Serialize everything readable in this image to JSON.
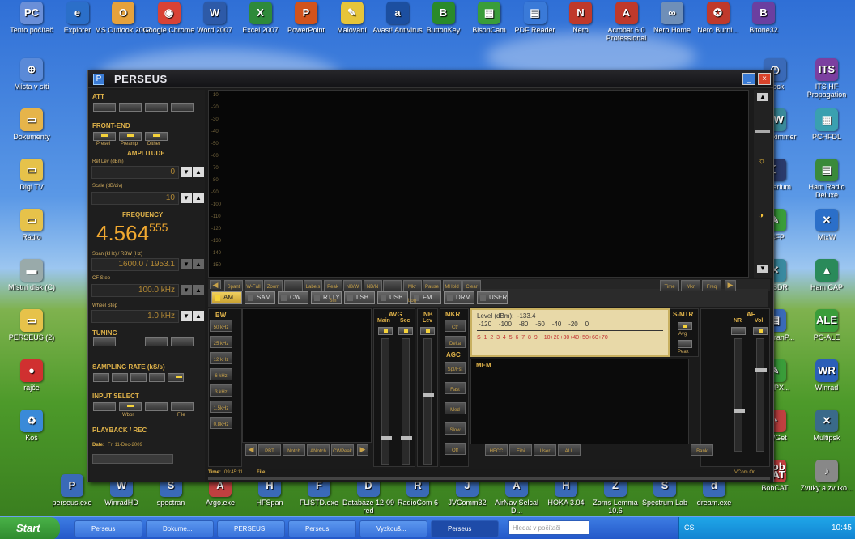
{
  "desktop": {
    "icons": [
      {
        "label": "Tento počítač",
        "color": "#6a8fd8",
        "glyph": "PC"
      },
      {
        "label": "Explorer",
        "color": "#2b6fc9",
        "glyph": "e"
      },
      {
        "label": "MS Outlook 2007",
        "color": "#e6a23c",
        "glyph": "O"
      },
      {
        "label": "Google Chrome",
        "color": "#d94235",
        "glyph": "◉"
      },
      {
        "label": "Word 2007",
        "color": "#2d5aa8",
        "glyph": "W"
      },
      {
        "label": "Excel 2007",
        "color": "#2e8a3a",
        "glyph": "X"
      },
      {
        "label": "PowerPoint",
        "color": "#d2531c",
        "glyph": "P"
      },
      {
        "label": "Malování",
        "color": "#e6c53a",
        "glyph": "✎"
      },
      {
        "label": "Avast! Antivirus",
        "color": "#1c4fa0",
        "glyph": "a"
      },
      {
        "label": "ButtonKey",
        "color": "#2a8a2a",
        "glyph": "B"
      },
      {
        "label": "BisonCam",
        "color": "#3a9d3a",
        "glyph": "▦"
      },
      {
        "label": "PDF Reader",
        "color": "#3a7ad8",
        "glyph": "▤"
      },
      {
        "label": "Nero",
        "color": "#c0392b",
        "glyph": "N"
      },
      {
        "label": "Acrobat 6.0 Professional",
        "color": "#c0392b",
        "glyph": "A"
      },
      {
        "label": "Nero Home",
        "color": "#6f8fb8",
        "glyph": "∞"
      },
      {
        "label": "Nero Burni...",
        "color": "#c0392b",
        "glyph": "✪"
      },
      {
        "label": "Bitone32",
        "color": "#6b3fa0",
        "glyph": "B"
      }
    ],
    "right_icons": [
      {
        "label": "ITS HF Propagation",
        "color": "#7b3fa0",
        "glyph": "ITS"
      },
      {
        "label": "PCHFDL",
        "color": "#3aa0b0",
        "glyph": "▦"
      },
      {
        "label": "Ham Radio Deluxe",
        "color": "#3a8a3a",
        "glyph": "▤"
      },
      {
        "label": "MixW",
        "color": "#2b6fc9",
        "glyph": "✕"
      },
      {
        "label": "Ham CAP",
        "color": "#2a8a5a",
        "glyph": "▲"
      },
      {
        "label": "PC-ALE",
        "color": "#3a9d3a",
        "glyph": "ALE"
      },
      {
        "label": "Winrad",
        "color": "#2b5fb8",
        "glyph": "WR"
      },
      {
        "label": "Multipsk",
        "color": "#3a6a8a",
        "glyph": "✕"
      },
      {
        "label": "Zvuky a zvuko...",
        "color": "#888",
        "glyph": "♪"
      }
    ],
    "col2": [
      {
        "label": "Clock",
        "color": "#3a6ab8",
        "glyph": "◷"
      },
      {
        "label": "CW Skimmer",
        "color": "#3a8a9a",
        "glyph": "CW"
      },
      {
        "label": "Stellarium",
        "color": "#2a3a6a",
        "glyph": "☾"
      },
      {
        "label": "...4FP",
        "color": "#3a9d3a",
        "glyph": "✎"
      },
      {
        "label": "HDSDR",
        "color": "#3a8aa0",
        "glyph": "✕"
      },
      {
        "label": "SpectranP...",
        "color": "#3a6ab8",
        "glyph": "▤"
      },
      {
        "label": "...4aPX...",
        "color": "#3a9d3a",
        "glyph": "✎"
      },
      {
        "label": "CWGet",
        "color": "#c04040",
        "glyph": "◔"
      },
      {
        "label": "BobCAT",
        "color": "#c04040",
        "glyph": "Bob CAT"
      }
    ],
    "left_icons": [
      {
        "label": "Místa v síti",
        "color": "#5a8ad8",
        "glyph": "⊕"
      },
      {
        "label": "Dokumenty",
        "color": "#e6b44a",
        "glyph": "▭"
      },
      {
        "label": "Digi TV",
        "color": "#e6c24a",
        "glyph": "▭"
      },
      {
        "label": "Rádio",
        "color": "#e6c24a",
        "glyph": "▭"
      },
      {
        "label": "Místní disk (C)",
        "color": "#9aa",
        "glyph": "▬"
      },
      {
        "label": "PERSEUS (2)",
        "color": "#e6c24a",
        "glyph": "▭"
      },
      {
        "label": "rajče",
        "color": "#d03030",
        "glyph": "●"
      },
      {
        "label": "Koš",
        "color": "#3a8ad8",
        "glyph": "♻"
      }
    ],
    "bottom_icons": [
      {
        "label": "perseus.exe",
        "color": "#3a6ab8",
        "glyph": "P"
      },
      {
        "label": "WinradHD",
        "color": "#3a6ab8",
        "glyph": "W"
      },
      {
        "label": "spectran",
        "color": "#3a6ab8",
        "glyph": "S"
      },
      {
        "label": "Argo.exe",
        "color": "#c04040",
        "glyph": "A"
      },
      {
        "label": "HFSpan",
        "color": "#3a6ab8",
        "glyph": "H"
      },
      {
        "label": "FLISTD.exe",
        "color": "#3a6ab8",
        "glyph": "F"
      },
      {
        "label": "Databáze 12-09 red",
        "color": "#3a6ab8",
        "glyph": "D"
      },
      {
        "label": "RadioCom 6",
        "color": "#3a6ab8",
        "glyph": "R"
      },
      {
        "label": "JVComm32",
        "color": "#3a6ab8",
        "glyph": "J"
      },
      {
        "label": "AirNav Selcal D...",
        "color": "#3a6ab8",
        "glyph": "A"
      },
      {
        "label": "HOKA 3.04",
        "color": "#3a6ab8",
        "glyph": "H"
      },
      {
        "label": "Zorns Lemma 10.6",
        "color": "#3a6ab8",
        "glyph": "Z"
      },
      {
        "label": "Spectrum Lab",
        "color": "#3a6ab8",
        "glyph": "S"
      },
      {
        "label": "dream.exe",
        "color": "#3a6ab8",
        "glyph": "d"
      }
    ]
  },
  "window": {
    "title": "PERSEUS",
    "logo": "P",
    "min_glyph": "_",
    "close_glyph": "×"
  },
  "left": {
    "att": "ATT",
    "frontend": "FRONT-END",
    "preset": "Presel",
    "preamp": "Preamp",
    "dither": "Dither",
    "amplitude": "AMPLITUDE",
    "ref_lev": "Ref Lev (dBm)",
    "ref_val": "0",
    "scale": "Scale (dB/div)",
    "scale_val": "10",
    "frequency": "FREQUENCY",
    "freq_main": "4.564",
    "freq_sub": "555",
    "span": "Span (kHz) / RBW (Hz)",
    "span_val": "1600.0 / 1953.1",
    "cf_step": "CF Step",
    "cf_val": "100.0 kHz",
    "wheel_step": "Wheel Step",
    "wheel_val": "1.0 kHz",
    "tuning": "TUNING",
    "sampling": "SAMPLING RATE (kS/s)",
    "input": "INPUT SELECT",
    "wbpr": "Wbpr",
    "file": "File",
    "playback": "PLAYBACK / REC",
    "up": "▲",
    "down": "▼"
  },
  "spectrum": {
    "ticks": [
      "-10",
      "-20",
      "-30",
      "-40",
      "-50",
      "-60",
      "-70",
      "-80",
      "-90",
      "-100",
      "-110",
      "-120",
      "-130",
      "-140",
      "-150"
    ]
  },
  "toolbar": {
    "left": [
      "Spant",
      "W-Fall",
      "Zoom",
      "",
      "Labels",
      "Peak Sm",
      "NB/W",
      "NB/N",
      "",
      "Mkr Log",
      "Pause",
      "MHold",
      "Clear"
    ],
    "right": [
      "Time",
      "Mkr",
      "Freq"
    ],
    "prev": "◀",
    "next": "▶"
  },
  "modes": [
    "AM",
    "SAM",
    "CW",
    "RTTY",
    "LSB",
    "USB",
    "FM",
    "DRM",
    "USER"
  ],
  "active_mode": "AM",
  "bw": {
    "label": "BW",
    "items": [
      "50 kHz",
      "25 kHz",
      "12 kHz",
      "6 kHz",
      "3 kHz",
      "1.5kHz",
      "0.8kHz"
    ],
    "bottom": [
      "PBT",
      "Notch",
      "ANotch",
      "CWPeak"
    ]
  },
  "avg": {
    "label": "AVG",
    "main": "Main",
    "sec": "Sec"
  },
  "nb": {
    "label": "NB",
    "lev": "Lev"
  },
  "mkr": {
    "label": "MKR",
    "items": [
      "Ctr",
      "Delta"
    ],
    "agc": "AGC",
    "agc_items": [
      "Spl/Fst",
      "Fast",
      "Med",
      "Slow",
      "Off"
    ]
  },
  "meter": {
    "level_label": "Level (dBm):",
    "level_val": "-133.4",
    "scale_top": "-120    -100    -80    -60    -40    -20    0",
    "scale_bot": "S  1  2  3  4  5  6  7  8  9  +10+20+30+40+50+60+70"
  },
  "smtr": {
    "label": "S-MTR",
    "items": [
      "Avg",
      "Peak"
    ]
  },
  "af": {
    "label": "AF",
    "nr": "NR",
    "vol": "Vol"
  },
  "mem": {
    "label": "MEM",
    "items": [
      "HFCC",
      "Eibi",
      "User",
      "ALL"
    ],
    "bank": "Bank"
  },
  "status": {
    "date_label": "Date:",
    "date": "Fri 11-Dec-2009",
    "time_label": "Time:",
    "time": "09:45:11",
    "file_label": "File:",
    "vcom": "VCom On"
  },
  "taskbar": {
    "start": "Start",
    "tasks": [
      "Perseus",
      "Dokume...",
      "PERSEUS",
      "Perseus",
      "Vyzkouš...",
      "Perseus"
    ],
    "search": "Hledat v počítači",
    "clock": "10:45",
    "lang": "CS"
  }
}
